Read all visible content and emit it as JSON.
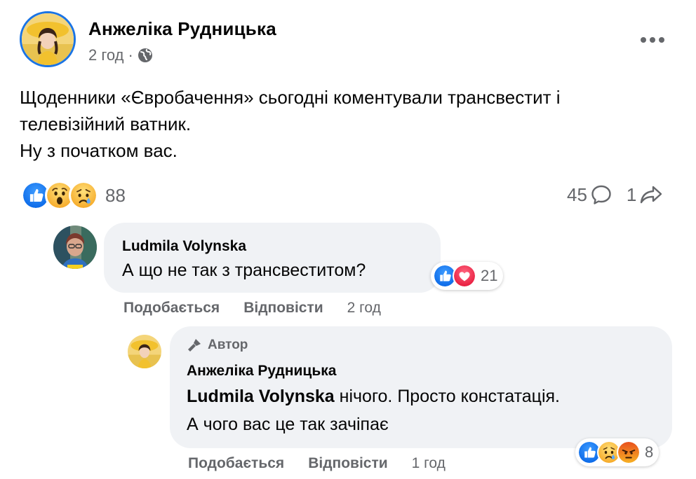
{
  "post": {
    "author": "Анжеліка Рудницька",
    "time": "2 год",
    "separator": "·",
    "text_lines": [
      "Щоденники «Євробачення» сьогодні коментували трансвестит і",
      "телевізійний ватник.",
      "Ну з початком вас."
    ],
    "reactions": [
      "like",
      "wow",
      "sad"
    ],
    "reactions_count": "88",
    "comments_count": "45",
    "shares_count": "1"
  },
  "comment1": {
    "author": "Ludmila Volynska",
    "text": "А що не так з трансвеститом?",
    "reactions": [
      "like",
      "love"
    ],
    "reactions_count": "21",
    "like_label": "Подобається",
    "reply_label": "Відповісти",
    "time": "2 год"
  },
  "reply1": {
    "badge": "Автор",
    "author": "Анжеліка Рудницька",
    "mention": "Ludmila Volynska",
    "text_line1": " нічого. Просто констатація.",
    "text_line2": "А чого вас це так зачіпає",
    "reactions": [
      "like",
      "sad",
      "angry"
    ],
    "reactions_count": "8",
    "like_label": "Подобається",
    "reply_label": "Відповісти",
    "time": "1 год"
  },
  "icons": {
    "like_color": "#1877f2",
    "love_color": "#f33e58",
    "wow_color": "#f7b125",
    "angry_color": "#e9710f"
  }
}
